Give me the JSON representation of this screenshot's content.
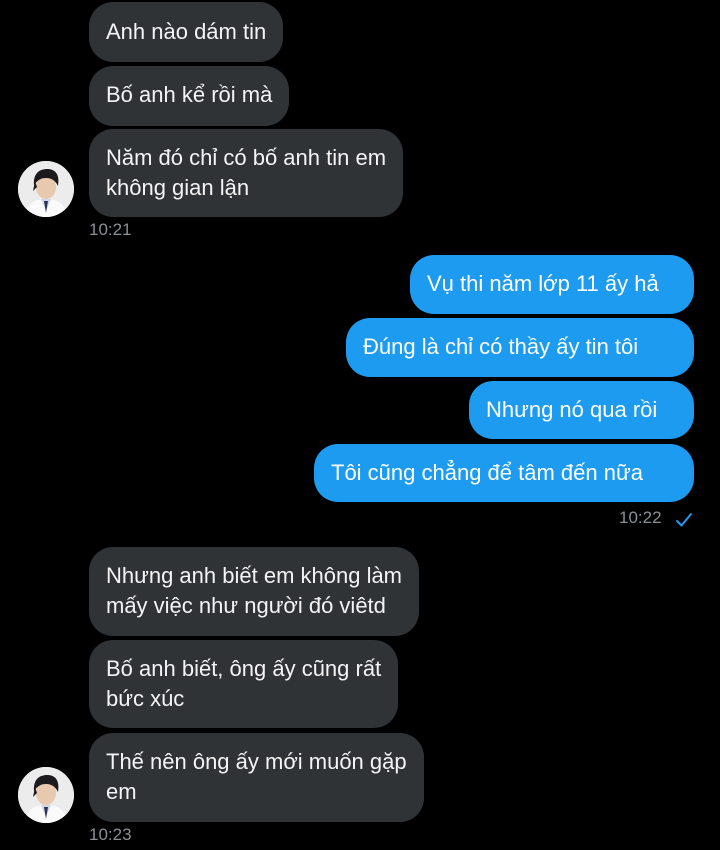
{
  "colors": {
    "background": "#000000",
    "incoming_bubble": "#2f3336",
    "outgoing_bubble": "#1d9bf0",
    "timestamp": "#8b8f94",
    "read_check": "#1d9bf0"
  },
  "group1": {
    "messages": [
      {
        "text": "Anh nào dám tin"
      },
      {
        "text": "Bố anh kể rồi mà"
      },
      {
        "text": "Năm đó chỉ có bố anh tin em\nkhông gian lận"
      }
    ],
    "time": "10:21",
    "avatar_icon": "profile-photo-avatar"
  },
  "group2": {
    "messages": [
      {
        "text": "Vụ thi năm lớp 11 ấy hả"
      },
      {
        "text": "Đúng là chỉ có thầy ấy tin tôi"
      },
      {
        "text": "Nhưng nó qua rồi"
      },
      {
        "text": "Tôi cũng chẳng để tâm đến nữa"
      }
    ],
    "time": "10:22",
    "status_icon": "read-check-icon"
  },
  "group3": {
    "messages": [
      {
        "text": "Nhưng anh biết em không làm\nmấy việc như người đó viêtd"
      },
      {
        "text": "Bố anh biết, ông ấy cũng rất\nbức xúc"
      },
      {
        "text": "Thế nên ông ấy mới muốn gặp\nem"
      }
    ],
    "time": "10:23",
    "avatar_icon": "profile-photo-avatar"
  }
}
